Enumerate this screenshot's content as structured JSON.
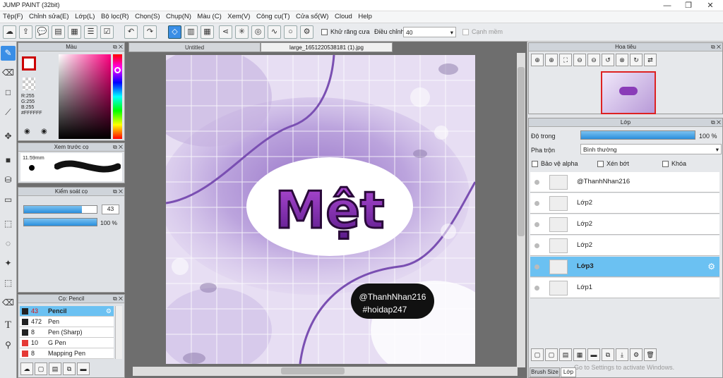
{
  "app": {
    "title": "JUMP PAINT (32bit)"
  },
  "window_controls": {
    "minimize": "—",
    "maximize": "❐",
    "close": "✕"
  },
  "menu": [
    "Tệp(F)",
    "Chỉnh sửa(E)",
    "Lớp(L)",
    "Bộ lọc(R)",
    "Chọn(S)",
    "Chụp(N)",
    "Màu (C)",
    "Xem(V)",
    "Công cụ(T)",
    "Cửa sổ(W)",
    "Cloud",
    "Help"
  ],
  "toolbar": {
    "antialias_label": "Khử răng cưa",
    "adjust_label": "Điều chỉnh",
    "adjust_value": "40",
    "edge_label": "Cạnh mềm"
  },
  "color_panel": {
    "title": "Màu",
    "r": "R:255",
    "g": "G:255",
    "b": "B:255",
    "hex": "#FFFFFF"
  },
  "brush_preview": {
    "title": "Xem trước cọ",
    "size": "11.59mm"
  },
  "brush_control": {
    "title": "Kiểm soát cọ",
    "size_value": "43",
    "opacity_value": "100 %",
    "size_fill": 0.8,
    "opacity_fill": 1.0
  },
  "brush_list": {
    "title": "Cọ: Pencil",
    "items": [
      {
        "size": "43",
        "name": "Pencil",
        "color": "#222222",
        "selected": true
      },
      {
        "size": "472",
        "name": "Pen",
        "color": "#222222",
        "selected": false
      },
      {
        "size": "8",
        "name": "Pen (Sharp)",
        "color": "#222222",
        "selected": false
      },
      {
        "size": "10",
        "name": "G Pen",
        "color": "#e53935",
        "selected": false
      },
      {
        "size": "8",
        "name": "Mapping Pen",
        "color": "#e53935",
        "selected": false
      }
    ]
  },
  "document_tabs": [
    "Untitled",
    "large_1651220538181 (1).jpg"
  ],
  "canvas": {
    "main_text": "Mệt",
    "credit_line1": "@ThanhNhan216",
    "credit_line2": "#hoidap247"
  },
  "navigator": {
    "title": "Hoa tiêu"
  },
  "layers_panel": {
    "title": "Lớp",
    "opacity_label": "Độ trong",
    "opacity_value": "100 %",
    "opacity_fill": 1.0,
    "blend_label": "Pha trộn",
    "blend_value": "Bình thường",
    "protect_alpha": "Bảo vệ alpha",
    "clipping": "Xén bớt",
    "lock": "Khóa",
    "layers": [
      {
        "name": "@ThanhNhan216",
        "selected": false
      },
      {
        "name": "Lớp2",
        "selected": false
      },
      {
        "name": "Lớp2",
        "selected": false
      },
      {
        "name": "Lớp2",
        "selected": false
      },
      {
        "name": "Lớp3",
        "selected": true
      },
      {
        "name": "Lớp1",
        "selected": false
      }
    ]
  },
  "bottom_tabs": [
    "Brush Size",
    "Lớp"
  ],
  "watermark": "Go to Settings to activate Windows."
}
